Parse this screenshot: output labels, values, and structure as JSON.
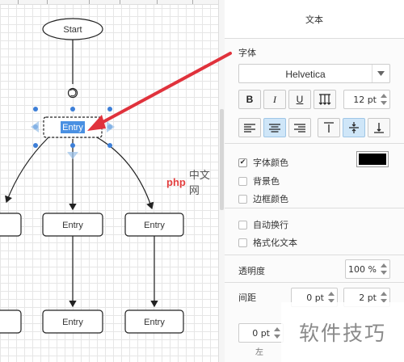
{
  "canvas": {
    "nodes": [
      {
        "id": "start",
        "label": "Start"
      },
      {
        "id": "entry-selected",
        "label": "Entry"
      },
      {
        "id": "entry-left-1",
        "label": ""
      },
      {
        "id": "entry-mid-1",
        "label": "Entry"
      },
      {
        "id": "entry-right-1",
        "label": "Entry"
      },
      {
        "id": "entry-mid-2",
        "label": "Entry"
      },
      {
        "id": "entry-right-2",
        "label": "Entry"
      }
    ],
    "accent_color": "#3d7fd8",
    "arrow_color": "#e0323c"
  },
  "panel": {
    "title": "文本",
    "font_section": {
      "label": "字体",
      "font_family": "Helvetica",
      "bold_label": "B",
      "italic_label": "I",
      "underline_label": "U",
      "font_size": "12 pt"
    },
    "color_section": {
      "font_color_label": "字体颜色",
      "font_color_checked": true,
      "font_color_value": "#000000",
      "background_label": "背景色",
      "border_color_label": "边框颜色"
    },
    "wrap_section": {
      "word_wrap_label": "自动换行",
      "formatted_text_label": "格式化文本"
    },
    "opacity": {
      "label": "透明度",
      "value": "100 %"
    },
    "spacing": {
      "label": "间距",
      "top_value": "0 pt",
      "global_value": "2 pt",
      "left_value": "0 pt",
      "left_label": "左"
    }
  },
  "watermarks": {
    "php_logo": "php",
    "php_site": "中文网",
    "soft": "软件技巧"
  }
}
